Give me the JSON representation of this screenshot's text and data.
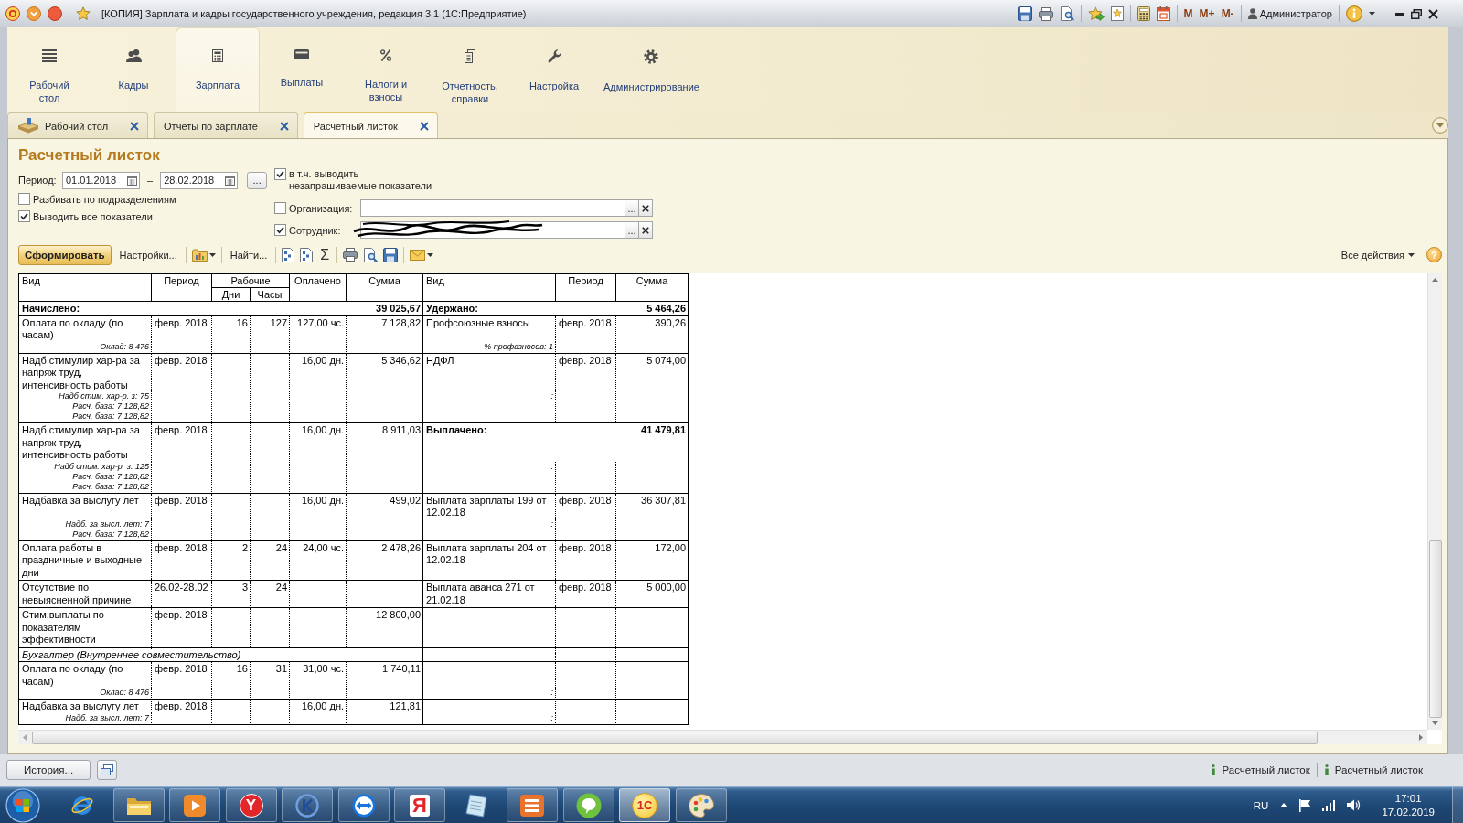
{
  "title_bar": {
    "title": "[КОПИЯ] Зарплата и кадры государственного учреждения, редакция 3.1 (1С:Предприятие)",
    "memory_buttons": [
      "M",
      "M+",
      "M-"
    ],
    "user": "Администратор"
  },
  "sections": [
    {
      "label": "Рабочий стол",
      "selected": false
    },
    {
      "label": "Кадры",
      "selected": false
    },
    {
      "label": "Зарплата",
      "selected": true
    },
    {
      "label": "Выплаты",
      "selected": false
    },
    {
      "label": "Налоги и взносы",
      "selected": false
    },
    {
      "label": "Отчетность, справки",
      "selected": false
    },
    {
      "label": "Настройка",
      "selected": false
    },
    {
      "label": "Администрирование",
      "selected": false
    }
  ],
  "open_tabs": [
    {
      "label": "Рабочий стол",
      "selected": false
    },
    {
      "label": "Отчеты по зарплате",
      "selected": false
    },
    {
      "label": "Расчетный листок",
      "selected": true
    }
  ],
  "form": {
    "title": "Расчетный листок",
    "period": {
      "label": "Период:",
      "from": "01.01.2018",
      "dash": "–",
      "to": "28.02.2018",
      "more_button": "..."
    },
    "options": [
      {
        "label": "Разбивать по подразделениям",
        "checked": false
      },
      {
        "label": "Выводить все показатели",
        "checked": true
      }
    ],
    "unrequested": {
      "label": "в т.ч. выводить незапрашиваемые показатели",
      "checked": true
    },
    "filters": [
      {
        "label": "Организация:",
        "checked": false,
        "redacted": false,
        "select_button": "..."
      },
      {
        "label": "Сотрудник:",
        "checked": true,
        "redacted": true,
        "select_button": "..."
      }
    ],
    "toolbar": {
      "generate_button": "Сформировать",
      "settings_button": "Настройки...",
      "find_button": "Найти...",
      "sum_button": "Σ",
      "all_actions": "Все действия",
      "help_button": "?"
    },
    "report": {
      "header": {
        "name": "Вид",
        "period": "Период",
        "working": "Рабочие",
        "days": "Дни",
        "hours": "Часы",
        "paid": "Оплачено",
        "sum": "Сумма",
        "right_name": "Вид",
        "right_period": "Период",
        "right_sum": "Сумма"
      },
      "rows": [
        {
          "left": {
            "kind": "total",
            "label": "Начислено:",
            "sum": "39 025,67"
          },
          "right": {
            "kind": "total",
            "label": "Удержано:",
            "sum": "5 464,26"
          }
        },
        {
          "left": {
            "kind": "item",
            "name": "Оплата по окладу (по часам)",
            "notes": [
              "Оклад: 8 476"
            ],
            "period": "февр. 2018",
            "days": "16",
            "hours": "127",
            "paid": "127,00 чс.",
            "sum": "7 128,82"
          },
          "right": {
            "kind": "item",
            "name": "Профсоюзные взносы",
            "notes": [
              "% профвзносов: 1"
            ],
            "period": "февр. 2018",
            "sum": "390,26"
          }
        },
        {
          "left": {
            "kind": "item",
            "name": "Надб стимулир хар-ра за напряж труд, интенсивность работы",
            "notes": [
              "Надб стим. хар-р. з: 75",
              "Расч. база: 7 128,82",
              "Расч. база: 7 128,82"
            ],
            "period": "февр. 2018",
            "paid": "16,00 дн.",
            "sum": "5 346,62"
          },
          "right": {
            "kind": "item",
            "name": "НДФЛ",
            "notes": [
              ":"
            ],
            "period": "февр. 2018",
            "sum": "5 074,00"
          }
        },
        {
          "left": {
            "kind": "item",
            "name": "Надб стимулир хар-ра за напряж труд, интенсивность работы",
            "notes": [
              "Надб стим. хар-р. з: 125",
              "Расч. база: 7 128,82",
              "Расч. база: 7 128,82"
            ],
            "period": "февр. 2018",
            "paid": "16,00 дн.",
            "sum": "8 911,03"
          },
          "right": {
            "kind": "total",
            "label": "Выплачено:",
            "sum": "41 479,81",
            "notes": [
              ":"
            ]
          }
        },
        {
          "left": {
            "kind": "item",
            "name": "Надбавка за выслугу лет",
            "notes": [
              "Надб. за высл. лет: 7",
              "Расч. база: 7 128,82"
            ],
            "period": "февр. 2018",
            "paid": "16,00 дн.",
            "sum": "499,02"
          },
          "right": {
            "kind": "item",
            "name": "Выплата зарплаты 199 от 12.02.18",
            "notes": [
              ":"
            ],
            "period": "февр. 2018",
            "sum": "36 307,81"
          }
        },
        {
          "left": {
            "kind": "item",
            "name": "Оплата работы в праздничные и выходные дни",
            "period": "февр. 2018",
            "days": "2",
            "hours": "24",
            "paid": "24,00 чс.",
            "sum": "2 478,26"
          },
          "right": {
            "kind": "item",
            "name": "Выплата зарплаты 204 от 12.02.18",
            "period": "февр. 2018",
            "sum": "172,00"
          }
        },
        {
          "left": {
            "kind": "item",
            "name": "Отсутствие по невыясненной причине",
            "period": "26.02-28.02",
            "days": "3",
            "hours": "24"
          },
          "right": {
            "kind": "item",
            "name": "Выплата аванса 271 от 21.02.18",
            "period": "февр. 2018",
            "sum": "5 000,00"
          }
        },
        {
          "left": {
            "kind": "item",
            "name": "Стим.выплаты по показателям эффективности",
            "period": "февр. 2018",
            "sum": "12 800,00"
          },
          "right": {
            "kind": "item"
          }
        },
        {
          "left": {
            "kind": "group",
            "label": "Бухгалтер (Внутреннее совместительство)"
          },
          "right": {
            "kind": "item"
          }
        },
        {
          "left": {
            "kind": "item",
            "name": "Оплата по окладу (по часам)",
            "notes": [
              "Оклад: 8 476"
            ],
            "period": "февр. 2018",
            "days": "16",
            "hours": "31",
            "paid": "31,00 чс.",
            "sum": "1 740,11"
          },
          "right": {
            "kind": "item",
            "notes": [
              ":"
            ]
          }
        },
        {
          "left": {
            "kind": "item",
            "name": "Надбавка за выслугу лет",
            "notes": [
              "Надб. за высл. лет: 7"
            ],
            "period": "февр. 2018",
            "paid": "16,00 дн.",
            "sum": "121,81"
          },
          "right": {
            "kind": "item",
            "notes": [
              ":"
            ]
          }
        }
      ]
    }
  },
  "history_bar": {
    "history_button": "История...",
    "windows": [
      "Расчетный листок",
      "Расчетный листок"
    ]
  },
  "taskbar": {
    "apps": [
      {
        "kind": "browser",
        "running": false,
        "selected": false
      },
      {
        "kind": "folder",
        "running": true,
        "selected": false
      },
      {
        "kind": "player",
        "running": true,
        "selected": false
      },
      {
        "kind": "disc",
        "glyph": "Y",
        "running": true,
        "selected": false
      },
      {
        "kind": "ring",
        "running": true,
        "selected": false
      },
      {
        "kind": "remote",
        "running": true,
        "selected": false
      },
      {
        "kind": "glyph",
        "glyph": "Я",
        "running": true,
        "selected": false
      },
      {
        "kind": "notepad",
        "running": false,
        "selected": false
      },
      {
        "kind": "tile",
        "running": true,
        "selected": false
      },
      {
        "kind": "chat",
        "running": true,
        "selected": false
      },
      {
        "kind": "coin",
        "glyph": "1С",
        "running": true,
        "selected": true
      },
      {
        "kind": "paint",
        "running": true,
        "selected": false
      }
    ],
    "language": "RU",
    "time": "17:01",
    "date": "17.02.2019"
  }
}
